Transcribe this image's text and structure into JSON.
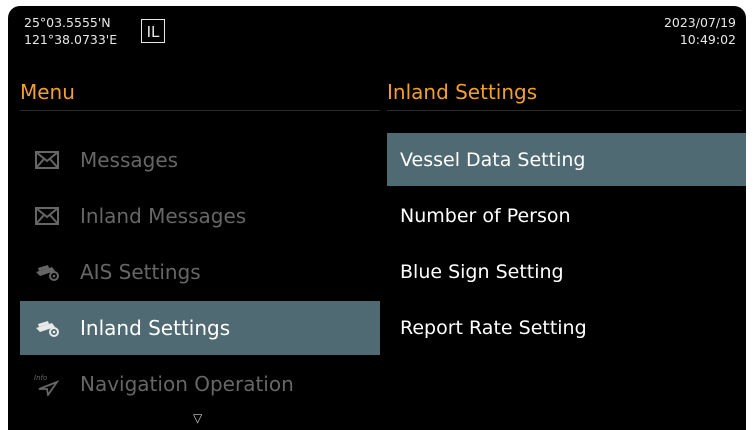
{
  "status": {
    "lat": "25°03.5555'N",
    "lon": "121°38.0733'E",
    "mode": "IL",
    "date": "2023/07/19",
    "time": "10:49:02"
  },
  "menu": {
    "title": "Menu",
    "items": [
      {
        "label": "Messages",
        "icon": "envelope-icon"
      },
      {
        "label": "Inland Messages",
        "icon": "envelope-icon"
      },
      {
        "label": "AIS Settings",
        "icon": "ship-gear-icon"
      },
      {
        "label": "Inland Settings",
        "icon": "ship-gear-icon"
      },
      {
        "label": "Navigation Operation",
        "icon": "info-navigation-icon"
      }
    ],
    "scroll_indicator": "▽"
  },
  "submenu": {
    "title": "Inland Settings",
    "items": [
      {
        "label": "Vessel Data Setting"
      },
      {
        "label": "Number of Person"
      },
      {
        "label": "Blue Sign Setting"
      },
      {
        "label": "Report Rate Setting"
      }
    ]
  },
  "colors": {
    "background": "#000000",
    "section_title": "#f0a030",
    "highlight": "#4f6a72",
    "dim_text": "#666666"
  }
}
